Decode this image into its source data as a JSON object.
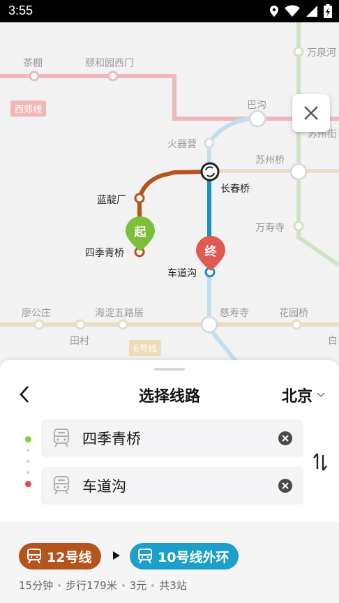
{
  "status_bar": {
    "time": "3:55",
    "icons": [
      "location-icon",
      "wifi-icon",
      "signal-icon",
      "battery-icon"
    ]
  },
  "map": {
    "stations_faded": [
      "茶棚",
      "颐和园西门",
      "万泉河",
      "巴沟",
      "苏州街",
      "火器营",
      "苏州桥",
      "万寿寺",
      "慈寿寺",
      "花园桥",
      "廖公庄",
      "海淀五路居",
      "田村",
      "白"
    ],
    "stations_route": [
      "蓝靛厂",
      "长春桥",
      "四季青桥",
      "车道沟"
    ],
    "line_tags": [
      "西郊线",
      "6号线"
    ],
    "pin_start": "起",
    "pin_end": "终",
    "colors": {
      "line12": "#b5541c",
      "line10": "#1c8fbd",
      "start": "#7bbf3a",
      "end": "#e05a55"
    }
  },
  "sheet": {
    "title": "选择线路",
    "city": "北京",
    "origin": "四季青桥",
    "destination": "车道沟"
  },
  "route": {
    "chips": [
      {
        "label": "12号线",
        "color": "#b5541c"
      },
      {
        "label": "10号线外环",
        "color": "#1c9fc8"
      }
    ],
    "info": [
      "15分钟",
      "步行179米",
      "3元",
      "共3站"
    ]
  }
}
